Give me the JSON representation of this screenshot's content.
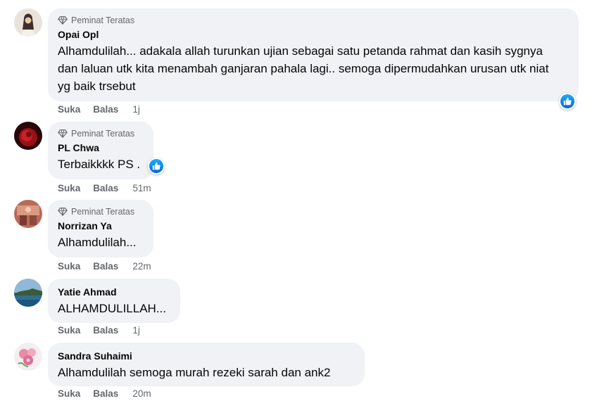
{
  "comments": [
    {
      "badge": "Peminat Teratas",
      "name": "Opai Opl",
      "text": "Alhamdulilah... adakala allah turunkan ujian sebagai satu petanda rahmat dan kasih sygnya dan laluan utk kita menambah ganjaran pahala lagi.. semoga dipermudahkan urusan utk niat yg baik trsebut",
      "like": "Suka",
      "reply": "Balas",
      "time": "1j"
    },
    {
      "badge": "Peminat Teratas",
      "name": "PL Chwa",
      "text": "Terbaikkkk PS .",
      "like": "Suka",
      "reply": "Balas",
      "time": "51m"
    },
    {
      "badge": "Peminat Teratas",
      "name": "Norrizan Ya",
      "text": "Alhamdulilah...",
      "like": "Suka",
      "reply": "Balas",
      "time": "22m"
    },
    {
      "name": "Yatie Ahmad",
      "text": "ALHAMDULILLAH...",
      "like": "Suka",
      "reply": "Balas",
      "time": "1j"
    },
    {
      "name": "Sandra Suhaimi",
      "text": "Alhamdulilah semoga murah rezeki sarah dan ank2",
      "like": "Suka",
      "reply": "Balas",
      "time": "20m"
    }
  ],
  "icons": {
    "badge": "diamond-icon",
    "reaction": "like-thumb-icon"
  },
  "colors": {
    "bubble": "#f0f2f5",
    "secondary_text": "#65676b",
    "like_blue": "#1877f2"
  }
}
